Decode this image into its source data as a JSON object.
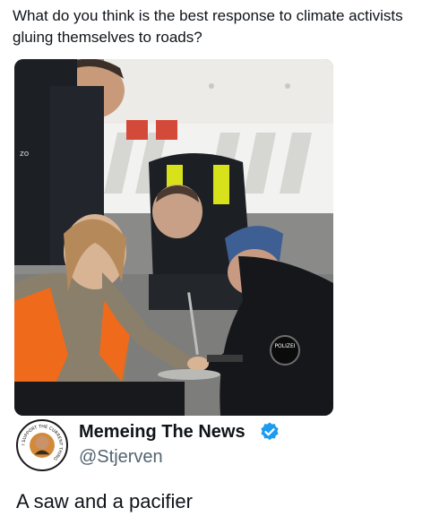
{
  "post": {
    "question": "What do you think is the best response to climate activists gluing themselves to roads?"
  },
  "photo": {
    "badge_text": "POLIZEI",
    "vest_text": "zo"
  },
  "author": {
    "display_name": "Memeing The News",
    "handle": "@Stjerven",
    "avatar_ring_text": "I SUPPORT THE CURRENT THING",
    "verified": true,
    "verified_color": "#1d9bf0"
  },
  "reply": {
    "text": "A saw and a pacifier"
  }
}
